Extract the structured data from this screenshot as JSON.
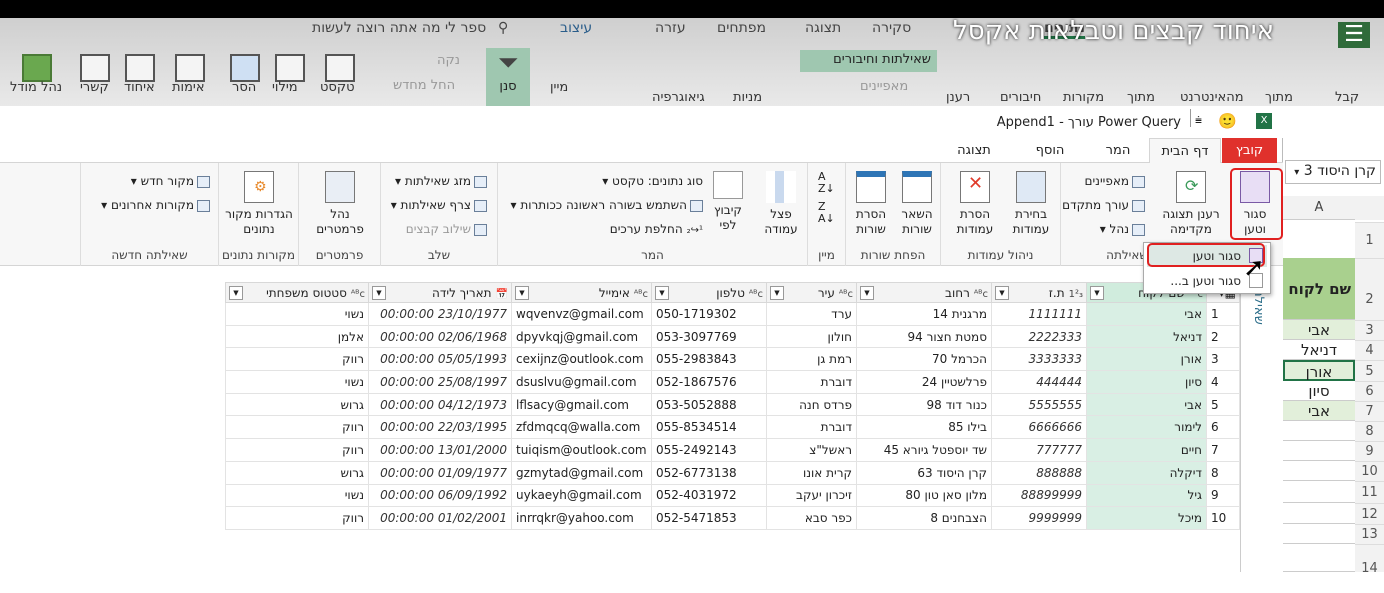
{
  "video_title": "איחוד קבצים וטבלאות אקסל",
  "excel": {
    "tabs": [
      "עזרה",
      "עיצוב",
      "מפתחים",
      "תצוגה",
      "סקירה",
      "נתונים"
    ],
    "active_tab": "נתונים",
    "search_placeholder": "ספר לי מה אתה רוצה לעשות",
    "buttons": [
      "נהל מודל",
      "קשרי",
      "איחוד",
      "אימות",
      "הסר",
      "מילוי",
      "טקסט",
      "החל מחדש",
      "נקה",
      "סנן",
      "מיין",
      "גיאוגרפיה",
      "מניות",
      "שאילתות וחיבורים",
      "מאפיינים",
      "רענן",
      "חיבורים",
      "מקורות",
      "מתוך",
      "מהאינטרנט",
      "מתוך",
      "קבל"
    ],
    "cut_label": "נתונים ▾ טקסט",
    "name_box": "קרן היסוד 3",
    "column_header": "A",
    "rows": [
      "1",
      "2",
      "3",
      "4",
      "5",
      "6",
      "7",
      "8",
      "9",
      "10",
      "11",
      "12",
      "13",
      "14"
    ],
    "cells": [
      "שם לקוח",
      "אבי",
      "דניאל",
      "אורן",
      "סיון",
      "אבי"
    ],
    "header_fill": "#a9d08e"
  },
  "pq": {
    "window_title": "Power Query עורך - Append1",
    "tabs": [
      "קובץ",
      "דף הבית",
      "המר",
      "הוסף עמודה",
      "תצוגה"
    ],
    "active_tab": "דף הבית",
    "file_tab_color": "#e0312c",
    "ribbon": {
      "close_load": "סגור וטען",
      "refresh_preview": "רענן תצוגה מקדימה",
      "properties": "מאפיינים",
      "advanced_editor": "עורך מתקדם",
      "manage": "נהל",
      "query_group": "שאילתה",
      "choose_columns": "בחירת עמודות",
      "remove_columns": "הסרת עמודות",
      "manage_columns_group": "ניהול עמודות",
      "keep_rows": "השאר שורות",
      "remove_rows": "הסרת שורות",
      "reduce_rows_group": "הפחת שורות",
      "sort_group": "מיין",
      "split_column": "פצל עמודה",
      "group_by": "קיבוץ לפי",
      "data_type": "סוג נתונים: טקסט",
      "first_row_headers": "השתמש בשורה ראשונה ככותרות",
      "replace_values": "החלפת ערכים",
      "transform_group": "המר",
      "merge_queries": "מזג שאילתות",
      "append_queries": "צרף שאילתות",
      "combine_files": "שילוב קבצים",
      "combine_group": "שלב",
      "manage_parameters": "נהל פרמטרים",
      "parameters_group": "פרמטרים",
      "data_source_settings": "הגדרות מקור נתונים",
      "data_sources_group": "מקורות נתונים",
      "new_source": "מקור חדש",
      "recent_sources": "מקורות אחרונים",
      "new_query_group": "שאילתה חדשה"
    },
    "menu": [
      "סגור וטען",
      "סגור וטען ב..."
    ],
    "queries_pane": "שאילתות",
    "columns": [
      {
        "name": "שם לקוח",
        "type": "ABC"
      },
      {
        "name": "ת.ז",
        "type": "123"
      },
      {
        "name": "רחוב",
        "type": "ABC"
      },
      {
        "name": "עיר",
        "type": "ABC"
      },
      {
        "name": "טלפון",
        "type": "ABC"
      },
      {
        "name": "אימייל",
        "type": "ABC"
      },
      {
        "name": "תאריך לידה",
        "type": "datetime"
      },
      {
        "name": "סטטוס משפחתי",
        "type": "ABC"
      }
    ],
    "rows": [
      [
        "אבי",
        "1111111",
        "מרגנית 14",
        "ערד",
        "050-1719302",
        "wqvenvz@gmail.com",
        "23/10/1977 00:00:00",
        "נשוי"
      ],
      [
        "דניאל",
        "2222333",
        "סמטת חצור 94",
        "חולון",
        "053-3097769",
        "dpyvkqj@gmail.com",
        "02/06/1968 00:00:00",
        "אלמן"
      ],
      [
        "אורן",
        "3333333",
        "הכרמל 70",
        "רמת גן",
        "055-2983843",
        "cexijnz@outlook.com",
        "05/05/1993 00:00:00",
        "רווק"
      ],
      [
        "סיון",
        "444444",
        "פרלשטיין 24",
        "דוברת",
        "052-1867576",
        "dsuslvu@gmail.com",
        "25/08/1997 00:00:00",
        "נשוי"
      ],
      [
        "אבי",
        "5555555",
        "כנור דוד 98",
        "פרדס חנה",
        "053-5052888",
        "lflsacy@gmail.com",
        "04/12/1973 00:00:00",
        "גרוש"
      ],
      [
        "לימור",
        "6666666",
        "בילו 85",
        "דוברת",
        "055-8534514",
        "zfdmqcq@walla.com",
        "22/03/1995 00:00:00",
        "רווק"
      ],
      [
        "חיים",
        "777777",
        "שד יוספטל גיורא 45",
        "ראשל\"צ",
        "055-2492143",
        "tuiqism@outlook.com",
        "13/01/2000 00:00:00",
        "רווק"
      ],
      [
        "דיקלה",
        "888888",
        "קרן היסוד 63",
        "קרית אונו",
        "052-6773138",
        "gzmytad@gmail.com",
        "01/09/1977 00:00:00",
        "גרוש"
      ],
      [
        "גיל",
        "88899999",
        "מלון סאן טון 80",
        "זיכרון יעקב",
        "052-4031972",
        "uykaeyh@gmail.com",
        "06/09/1992 00:00:00",
        "נשוי"
      ],
      [
        "מיכל",
        "9999999",
        "הצבחנים 8",
        "כפר סבא",
        "052-5471853",
        "inrrqkr@yahoo.com",
        "01/02/2001 00:00:00",
        "רווק"
      ]
    ]
  }
}
